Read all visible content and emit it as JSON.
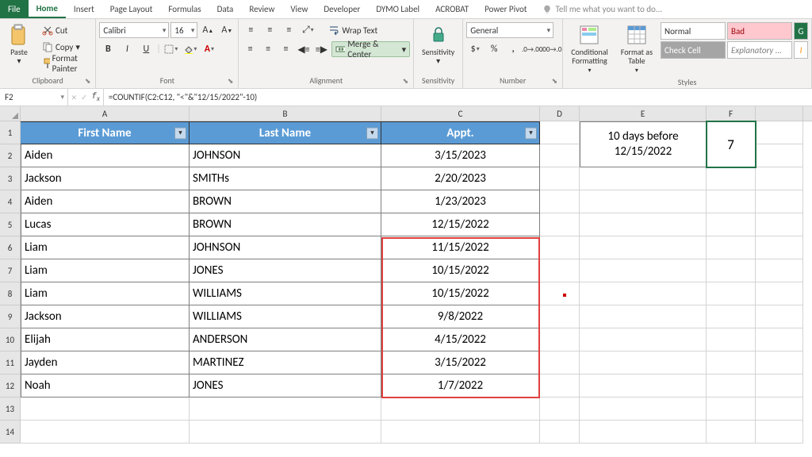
{
  "tabs": [
    "File",
    "Home",
    "Insert",
    "Page Layout",
    "Formulas",
    "Data",
    "Review",
    "View",
    "Developer",
    "DYMO Label",
    "ACROBAT",
    "Power Pivot"
  ],
  "tell": "Tell me what you want to do...",
  "clipboard": {
    "paste": "Paste",
    "cut": "Cut",
    "copy": "Copy",
    "fp": "Format Painter",
    "label": "Clipboard"
  },
  "font": {
    "name": "Calibri",
    "size": "16",
    "label": "Font"
  },
  "alignment": {
    "wrap": "Wrap Text",
    "merge": "Merge & Center",
    "label": "Alignment"
  },
  "sensitivity": {
    "btn": "Sensitivity",
    "label": "Sensitivity"
  },
  "number": {
    "fmt": "General",
    "label": "Number"
  },
  "styles": {
    "cond": "Conditional\nFormatting",
    "fat": "Format as\nTable",
    "normal": "Normal",
    "bad": "Bad",
    "check": "Check Cell",
    "expl": "Explanatory ...",
    "label": "Styles"
  },
  "namebox": "F2",
  "formula": "=COUNTIF(C2:C12, \"<\"&\"12/15/2022\"-10)",
  "cols": [
    "A",
    "B",
    "C",
    "D",
    "E",
    "F"
  ],
  "headers": {
    "a": "First Name",
    "b": "Last Name",
    "c": "Appt."
  },
  "rows": [
    {
      "a": "Aiden",
      "b": "JOHNSON",
      "c": "3/15/2023"
    },
    {
      "a": "Jackson",
      "b": "SMITHs",
      "c": "2/20/2023"
    },
    {
      "a": "Aiden",
      "b": "BROWN",
      "c": "1/23/2023"
    },
    {
      "a": "Lucas",
      "b": "BROWN",
      "c": "12/15/2022"
    },
    {
      "a": "Liam",
      "b": "JOHNSON",
      "c": "11/15/2022"
    },
    {
      "a": "Liam",
      "b": "JONES",
      "c": "10/15/2022"
    },
    {
      "a": "Liam",
      "b": "WILLIAMS",
      "c": "10/15/2022"
    },
    {
      "a": "Jackson",
      "b": "WILLIAMS",
      "c": "9/8/2022"
    },
    {
      "a": "Elijah",
      "b": "ANDERSON",
      "c": "4/15/2022"
    },
    {
      "a": "Jayden",
      "b": "MARTINEZ",
      "c": "3/15/2022"
    },
    {
      "a": "Noah",
      "b": "JONES",
      "c": "1/7/2022"
    }
  ],
  "note": {
    "text": "10 days before 12/15/2022"
  },
  "result": "7"
}
